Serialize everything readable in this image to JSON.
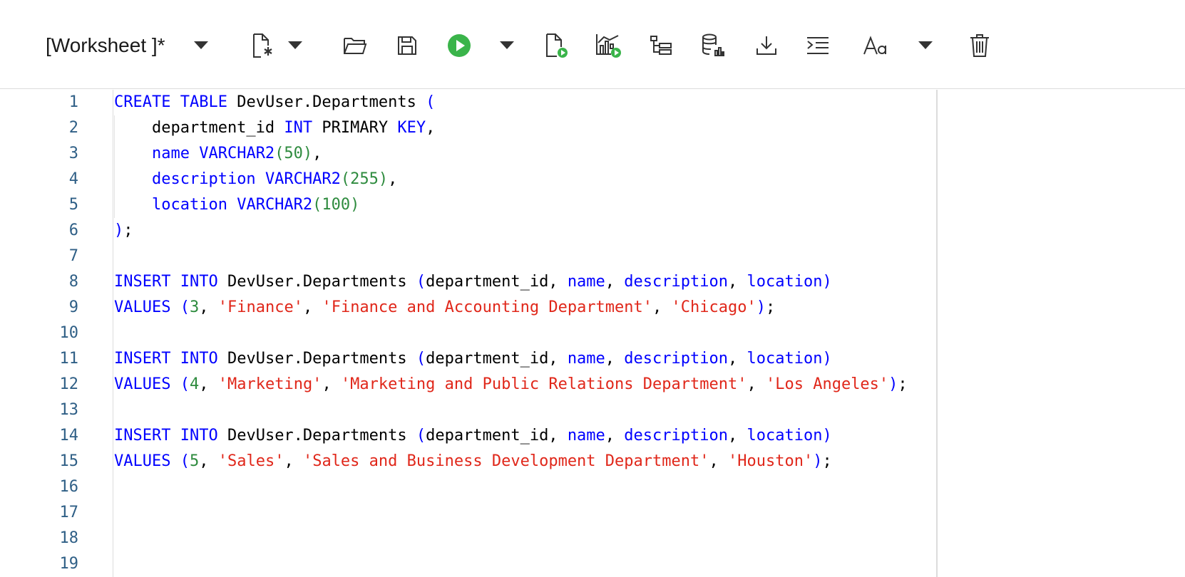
{
  "toolbar": {
    "worksheet_title": "[Worksheet ]*",
    "buttons": [
      {
        "name": "worksheet-menu-button",
        "icon": "chevron-down-icon"
      },
      {
        "name": "new-worksheet-button",
        "icon": "new-file-icon"
      },
      {
        "name": "new-worksheet-dropdown-button",
        "icon": "chevron-down-icon"
      },
      {
        "name": "open-button",
        "icon": "folder-open-icon"
      },
      {
        "name": "save-button",
        "icon": "save-icon"
      },
      {
        "name": "run-statement-button",
        "icon": "play-icon"
      },
      {
        "name": "run-dropdown-button",
        "icon": "chevron-down-icon"
      },
      {
        "name": "run-script-button",
        "icon": "run-script-icon"
      },
      {
        "name": "autotrace-button",
        "icon": "chart-run-icon"
      },
      {
        "name": "explain-plan-button",
        "icon": "tree-icon"
      },
      {
        "name": "database-stats-button",
        "icon": "database-chart-icon"
      },
      {
        "name": "download-button",
        "icon": "download-icon"
      },
      {
        "name": "format-button",
        "icon": "indent-icon"
      },
      {
        "name": "font-size-button",
        "icon": "font-size-icon"
      },
      {
        "name": "font-size-dropdown-button",
        "icon": "chevron-down-icon"
      },
      {
        "name": "clear-button",
        "icon": "trash-icon"
      }
    ],
    "colors": {
      "run_green": "#3ab44a",
      "icon": "#333333"
    }
  },
  "editor": {
    "line_numbers": [
      "1",
      "2",
      "3",
      "4",
      "5",
      "6",
      "7",
      "8",
      "9",
      "10",
      "11",
      "12",
      "13",
      "14",
      "15",
      "16",
      "17",
      "18",
      "19"
    ],
    "lines": [
      [
        [
          "kw",
          "CREATE"
        ],
        [
          "id",
          " "
        ],
        [
          "kw",
          "TABLE"
        ],
        [
          "id",
          " DevUser.Departments "
        ],
        [
          "paren",
          "("
        ]
      ],
      [
        [
          "id",
          "    department_id "
        ],
        [
          "kw",
          "INT"
        ],
        [
          "id",
          " PRIMARY "
        ],
        [
          "kw",
          "KEY"
        ],
        [
          "id",
          ","
        ]
      ],
      [
        [
          "id",
          "    "
        ],
        [
          "kw",
          "name"
        ],
        [
          "id",
          " "
        ],
        [
          "kw",
          "VARCHAR2"
        ],
        [
          "np",
          "(50)"
        ],
        [
          "id",
          ","
        ]
      ],
      [
        [
          "id",
          "    "
        ],
        [
          "kw",
          "description"
        ],
        [
          "id",
          " "
        ],
        [
          "kw",
          "VARCHAR2"
        ],
        [
          "np",
          "(255)"
        ],
        [
          "id",
          ","
        ]
      ],
      [
        [
          "id",
          "    "
        ],
        [
          "kw",
          "location"
        ],
        [
          "id",
          " "
        ],
        [
          "kw",
          "VARCHAR2"
        ],
        [
          "np",
          "(100)"
        ]
      ],
      [
        [
          "paren",
          ")"
        ],
        [
          "id",
          ";"
        ]
      ],
      [],
      [
        [
          "kw",
          "INSERT"
        ],
        [
          "id",
          " "
        ],
        [
          "kw",
          "INTO"
        ],
        [
          "id",
          " DevUser.Departments "
        ],
        [
          "paren",
          "("
        ],
        [
          "id",
          "department_id, "
        ],
        [
          "kw",
          "name"
        ],
        [
          "id",
          ", "
        ],
        [
          "kw",
          "description"
        ],
        [
          "id",
          ", "
        ],
        [
          "kw",
          "location"
        ],
        [
          "paren",
          ")"
        ]
      ],
      [
        [
          "kw",
          "VALUES"
        ],
        [
          "id",
          " "
        ],
        [
          "paren",
          "("
        ],
        [
          "num",
          "3"
        ],
        [
          "id",
          ", "
        ],
        [
          "str",
          "'Finance'"
        ],
        [
          "id",
          ", "
        ],
        [
          "str",
          "'Finance and Accounting Department'"
        ],
        [
          "id",
          ", "
        ],
        [
          "str",
          "'Chicago'"
        ],
        [
          "paren",
          ")"
        ],
        [
          "id",
          ";"
        ]
      ],
      [],
      [
        [
          "kw",
          "INSERT"
        ],
        [
          "id",
          " "
        ],
        [
          "kw",
          "INTO"
        ],
        [
          "id",
          " DevUser.Departments "
        ],
        [
          "paren",
          "("
        ],
        [
          "id",
          "department_id, "
        ],
        [
          "kw",
          "name"
        ],
        [
          "id",
          ", "
        ],
        [
          "kw",
          "description"
        ],
        [
          "id",
          ", "
        ],
        [
          "kw",
          "location"
        ],
        [
          "paren",
          ")"
        ]
      ],
      [
        [
          "kw",
          "VALUES"
        ],
        [
          "id",
          " "
        ],
        [
          "paren",
          "("
        ],
        [
          "num",
          "4"
        ],
        [
          "id",
          ", "
        ],
        [
          "str",
          "'Marketing'"
        ],
        [
          "id",
          ", "
        ],
        [
          "str",
          "'Marketing and Public Relations Department'"
        ],
        [
          "id",
          ", "
        ],
        [
          "str",
          "'Los Angeles'"
        ],
        [
          "paren",
          ")"
        ],
        [
          "id",
          ";"
        ]
      ],
      [],
      [
        [
          "kw",
          "INSERT"
        ],
        [
          "id",
          " "
        ],
        [
          "kw",
          "INTO"
        ],
        [
          "id",
          " DevUser.Departments "
        ],
        [
          "paren",
          "("
        ],
        [
          "id",
          "department_id, "
        ],
        [
          "kw",
          "name"
        ],
        [
          "id",
          ", "
        ],
        [
          "kw",
          "description"
        ],
        [
          "id",
          ", "
        ],
        [
          "kw",
          "location"
        ],
        [
          "paren",
          ")"
        ]
      ],
      [
        [
          "kw",
          "VALUES"
        ],
        [
          "id",
          " "
        ],
        [
          "paren",
          "("
        ],
        [
          "num",
          "5"
        ],
        [
          "id",
          ", "
        ],
        [
          "str",
          "'Sales'"
        ],
        [
          "id",
          ", "
        ],
        [
          "str",
          "'Sales and Business Development Department'"
        ],
        [
          "id",
          ", "
        ],
        [
          "str",
          "'Houston'"
        ],
        [
          "paren",
          ")"
        ],
        [
          "id",
          ";"
        ]
      ],
      [],
      [],
      [],
      []
    ]
  }
}
